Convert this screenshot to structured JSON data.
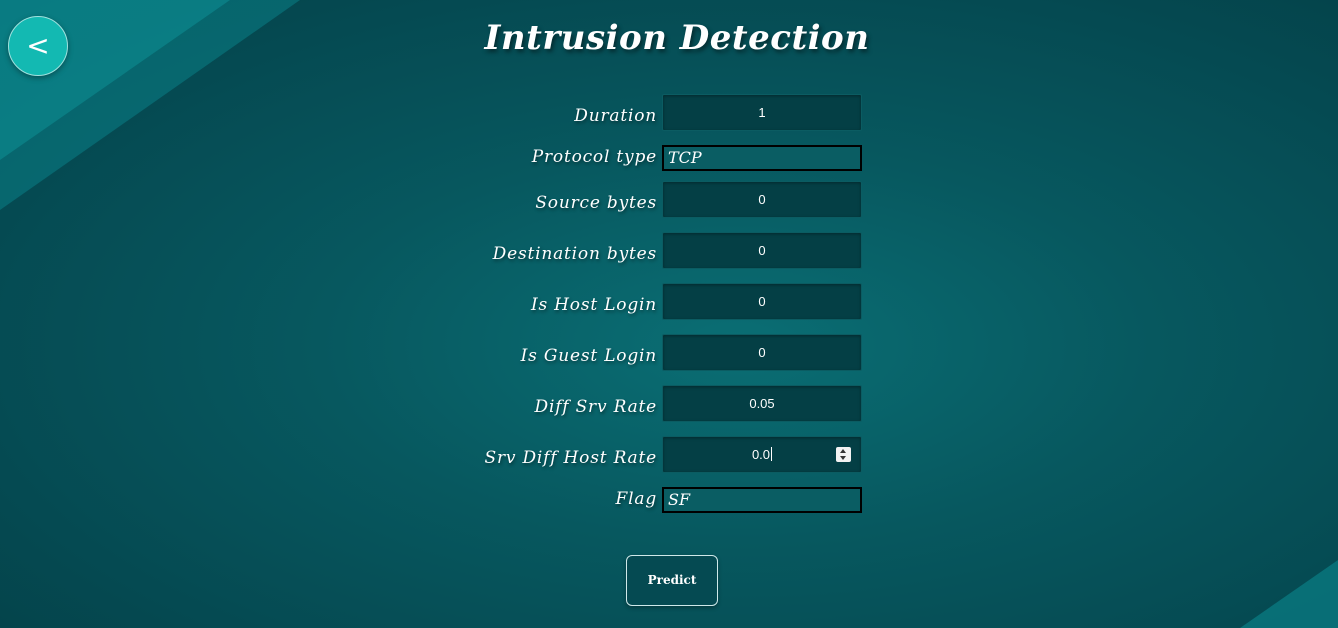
{
  "header": {
    "title": "Intrusion Detection",
    "back_label": "<"
  },
  "form": {
    "fields": [
      {
        "label": "Duration",
        "value": "1"
      },
      {
        "label": "Protocol type",
        "value": "TCP"
      },
      {
        "label": "Source bytes",
        "value": "0"
      },
      {
        "label": "Destination bytes",
        "value": "0"
      },
      {
        "label": "Is Host Login",
        "value": "0"
      },
      {
        "label": "Is Guest Login",
        "value": "0"
      },
      {
        "label": "Diff Srv Rate",
        "value": "0.05"
      },
      {
        "label": "Srv Diff Host Rate",
        "value": "0.0"
      },
      {
        "label": "Flag",
        "value": "SF"
      }
    ],
    "submit_label": "Predict"
  },
  "colors": {
    "background": "#07585f",
    "accent": "#13b9b2",
    "input_background": "#043f45"
  },
  "icons": {
    "back": "back-chevron-icon",
    "spinner": "number-spinner-icon"
  }
}
